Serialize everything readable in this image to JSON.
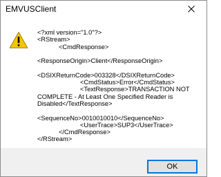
{
  "window": {
    "title": "EMVUSClient"
  },
  "icons": {
    "status": "warning-icon",
    "close": "close-icon"
  },
  "message": {
    "text": "<?xml version=\"1.0\"?>\n<RStream>\n            <CmdResponse>\n\n<ResponseOrigin>Client</ResponseOrigin>\n\n<DSIXReturnCode>003328</DSIXReturnCode>\n                        <CmdStatus>Error</CmdStatus>\n                        <TextResponse>TRANSACTION NOT\nCOMPLETE - At Least One Specified Reader is\nDisabled</TextResponse>\n\n<SequenceNo>0010010010</SequenceNo>\n                        <UserTrace>SUP3</UserTrace>\n            </CmdResponse>\n</RStream>"
  },
  "buttons": {
    "ok_label": "OK"
  },
  "colors": {
    "warning_fill": "#f7c600",
    "warning_border": "#a07e00",
    "footer_background": "#f0f0f0",
    "button_focus_border": "#0078d7"
  }
}
